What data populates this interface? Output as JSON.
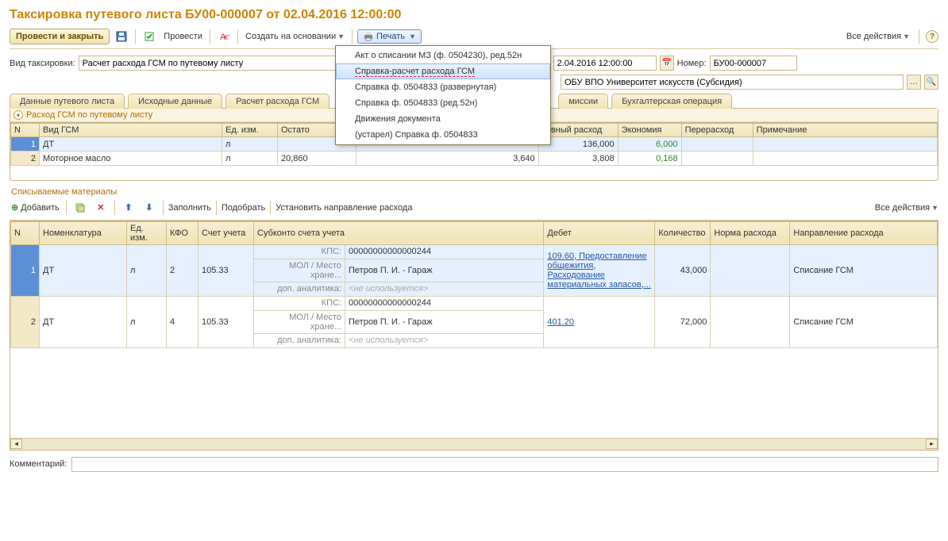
{
  "title": "Таксировка путевого листа БУ00-000007 от 02.04.2016 12:00:00",
  "toolbar": {
    "post_close": "Провести и закрыть",
    "post": "Провести",
    "create_base": "Создать на основании",
    "print": "Печать",
    "all_actions": "Все действия",
    "help": "?"
  },
  "print_menu": [
    "Акт о списании МЗ (ф. 0504230), ред.52н",
    "Справка-расчет расхода ГСМ",
    "Справка ф. 0504833 (развернутая)",
    "Справка ф. 0504833 (ред.52н)",
    "Движения документа",
    "(устарел) Справка ф. 0504833"
  ],
  "info": {
    "type_label": "Вид таксировки:",
    "type_value": "Расчет расхода ГСМ по путевому листу",
    "date_value": "2.04.2016 12:00:00",
    "number_label": "Номер:",
    "number_value": "БУ00-000007",
    "org_value": "ОБУ ВПО Университет искусств (Субсидия)"
  },
  "tabs": [
    "Данные путевого листа",
    "Исходные данные",
    "Расчет расхода ГСМ",
    "миссии",
    "Бухгалтерская операция"
  ],
  "group_title": "Расход ГСМ по путевому листу",
  "grid1": {
    "cols": [
      "N",
      "Вид ГСМ",
      "Ед. изм.",
      "Остато",
      "тивный расход",
      "Экономия",
      "Перерасход",
      "Примечание"
    ],
    "rows": [
      {
        "n": "1",
        "name": "ДТ",
        "unit": "л",
        "norm": "136,000",
        "eco": "6,000",
        "sel": true
      },
      {
        "n": "2",
        "name": "Моторное масло",
        "unit": "л",
        "rest": "20,860",
        "after": "3,640",
        "norm": "3,808",
        "eco": "0,168"
      }
    ]
  },
  "spmat_label": "Списываемые материалы",
  "toolbar2": {
    "add": "Добавить",
    "fill": "Заполнить",
    "pick": "Подобрать",
    "setdir": "Установить направление расхода",
    "all_actions": "Все действия"
  },
  "grid2": {
    "cols": [
      "N",
      "Номенклатура",
      "Ед. изм.",
      "КФО",
      "Счет учета",
      "Субконто счета учета",
      "Дебет",
      "Количество",
      "Норма расхода",
      "Направление расхода"
    ],
    "sub_labels": {
      "kps": "КПС:",
      "mol": "МОЛ / Место хране...",
      "dop": "доп. аналитика:"
    },
    "sub_empty": "<не используется>",
    "rows": [
      {
        "n": "1",
        "nom": "ДТ",
        "unit": "л",
        "kfo": "2",
        "acct": "105.33",
        "kps": "00000000000000244",
        "mol": "Петров П. И. - Гараж",
        "debet": "109.60, Предоставление общежития, Расходование материальных запасов,...",
        "qty": "43,000",
        "dir": "Списание ГСМ",
        "sel": true
      },
      {
        "n": "2",
        "nom": "ДТ",
        "unit": "л",
        "kfo": "4",
        "acct": "105.33",
        "kps": "00000000000000244",
        "mol": "Петров П. И. - Гараж",
        "debet": "401.20",
        "qty": "72,000",
        "dir": "Списание ГСМ"
      }
    ]
  },
  "comment_label": "Комментарий:"
}
